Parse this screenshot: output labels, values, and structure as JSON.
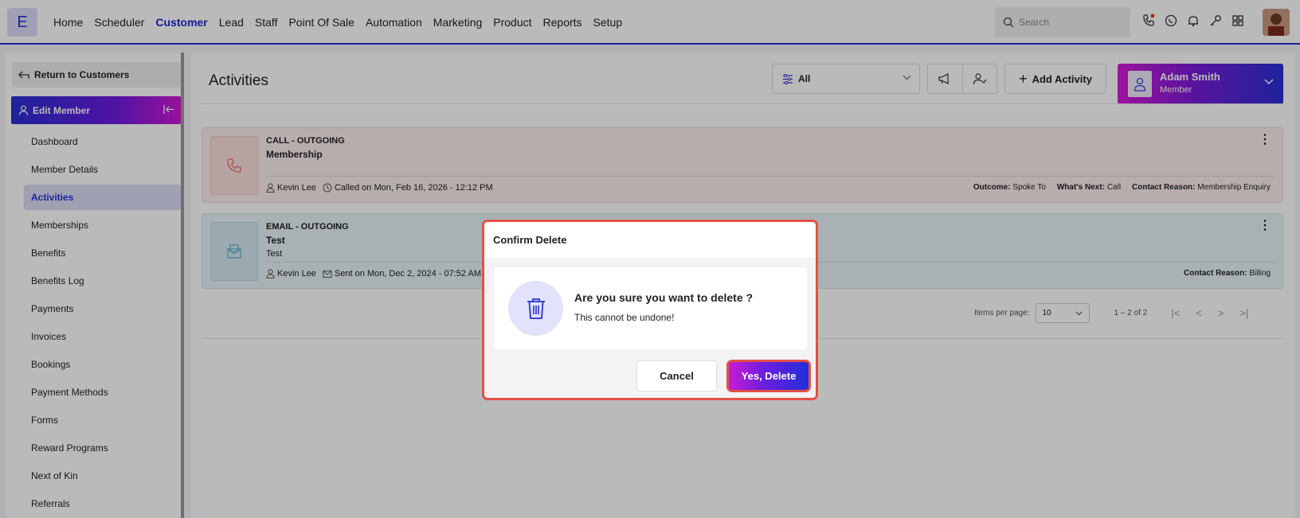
{
  "topnav": {
    "logo": "E",
    "menu": [
      "Home",
      "Scheduler",
      "Customer",
      "Lead",
      "Staff",
      "Point Of Sale",
      "Automation",
      "Marketing",
      "Product",
      "Reports",
      "Setup"
    ],
    "active_menu": "Customer",
    "search_placeholder": "Search"
  },
  "sidebar": {
    "return_label": "Return to Customers",
    "section_label": "Edit Member",
    "items": [
      "Dashboard",
      "Member Details",
      "Activities",
      "Memberships",
      "Benefits",
      "Benefits Log",
      "Payments",
      "Invoices",
      "Bookings",
      "Payment Methods",
      "Forms",
      "Reward Programs",
      "Next of Kin",
      "Referrals"
    ],
    "active_item": "Activities"
  },
  "main": {
    "title": "Activities",
    "filter_value": "All",
    "add_activity_label": "Add Activity",
    "user": {
      "name": "Adam Smith",
      "role": "Member"
    },
    "activities": [
      {
        "type": "CALL - OUTGOING",
        "subject": "Membership",
        "body": "",
        "staff": "Kevin Lee",
        "when": "Called on Mon, Feb 16, 2026 - 12:12 PM",
        "details": [
          {
            "label": "Outcome:",
            "value": "Spoke To"
          },
          {
            "label": "What's Next:",
            "value": "Call"
          },
          {
            "label": "Contact Reason:",
            "value": "Membership Enquiry"
          }
        ]
      },
      {
        "type": "EMAIL - OUTGOING",
        "subject": "Test",
        "body": "Test",
        "staff": "Kevin Lee",
        "when": "Sent on Mon, Dec 2, 2024 - 07:52 AM",
        "details": [
          {
            "label": "Contact Reason:",
            "value": "Billing"
          }
        ]
      }
    ],
    "pager": {
      "items_per_page_label": "Items per page:",
      "items_per_page": "10",
      "range": "1 – 2 of 2"
    }
  },
  "dialog": {
    "title": "Confirm Delete",
    "question": "Are you sure you want to delete ?",
    "note": "This cannot be undone!",
    "cancel_label": "Cancel",
    "confirm_label": "Yes, Delete"
  },
  "colors": {
    "brand": "#2a2fd6",
    "accent_magenta": "#d01ad6",
    "danger_outline": "#e55045"
  }
}
